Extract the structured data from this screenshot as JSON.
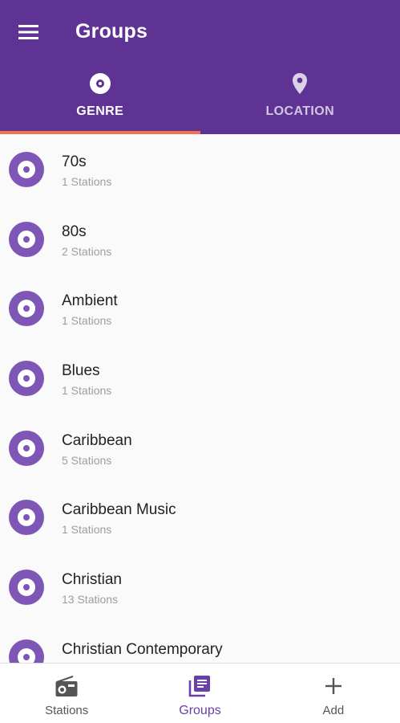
{
  "header": {
    "title": "Groups",
    "menu_icon": "menu-icon"
  },
  "tabs": [
    {
      "label": "GENRE",
      "icon": "album-icon",
      "active": true
    },
    {
      "label": "LOCATION",
      "icon": "location-pin-icon",
      "active": false
    }
  ],
  "groups": [
    {
      "name": "70s",
      "count": "1 Stations"
    },
    {
      "name": "80s",
      "count": "2 Stations"
    },
    {
      "name": "Ambient",
      "count": "1 Stations"
    },
    {
      "name": "Blues",
      "count": "1 Stations"
    },
    {
      "name": "Caribbean",
      "count": "5 Stations"
    },
    {
      "name": "Caribbean Music",
      "count": "1 Stations"
    },
    {
      "name": "Christian",
      "count": "13 Stations"
    },
    {
      "name": "Christian Contemporary",
      "count": ""
    }
  ],
  "bottom_nav": [
    {
      "label": "Stations",
      "icon": "radio-icon",
      "active": false
    },
    {
      "label": "Groups",
      "icon": "library-icon",
      "active": true
    },
    {
      "label": "Add",
      "icon": "plus-icon",
      "active": false
    }
  ],
  "colors": {
    "primary": "#5e3393",
    "accent": "#f2734f",
    "avatar": "#7e57b6",
    "active_nav": "#6a3fa8"
  }
}
